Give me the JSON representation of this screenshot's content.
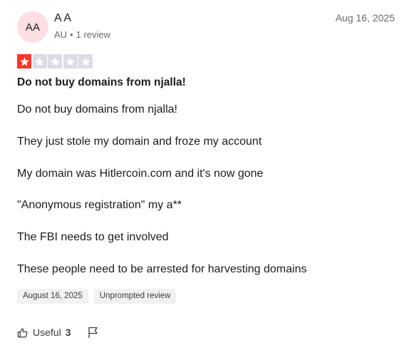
{
  "reviewer": {
    "initials": "AA",
    "name": "A A",
    "country": "AU",
    "separator": "•",
    "review_count": "1 review"
  },
  "review": {
    "date": "Aug 16, 2025",
    "rating": 1,
    "max_rating": 5,
    "title": "Do not buy domains from njalla!",
    "paragraphs": [
      "Do not buy domains from njalla!",
      "They just stole my domain and froze my account",
      "My domain was Hitlercoin.com and it's now gone",
      "\"Anonymous registration\" my a**",
      "The FBI needs to get involved",
      "These people need to be arrested for harvesting domains"
    ],
    "tags": {
      "date_of_experience": "August 16, 2025",
      "review_type": "Unprompted review"
    }
  },
  "actions": {
    "useful_label": "Useful",
    "useful_count": "3",
    "useful_icon": "thumbs-up-icon",
    "report_icon": "flag-icon"
  },
  "colors": {
    "star_filled": "#ff3722",
    "star_empty": "#dcdce6",
    "avatar_bg": "#fbdfe4",
    "tag_bg": "#f1f1ef",
    "muted_text": "#6a6a6a"
  }
}
